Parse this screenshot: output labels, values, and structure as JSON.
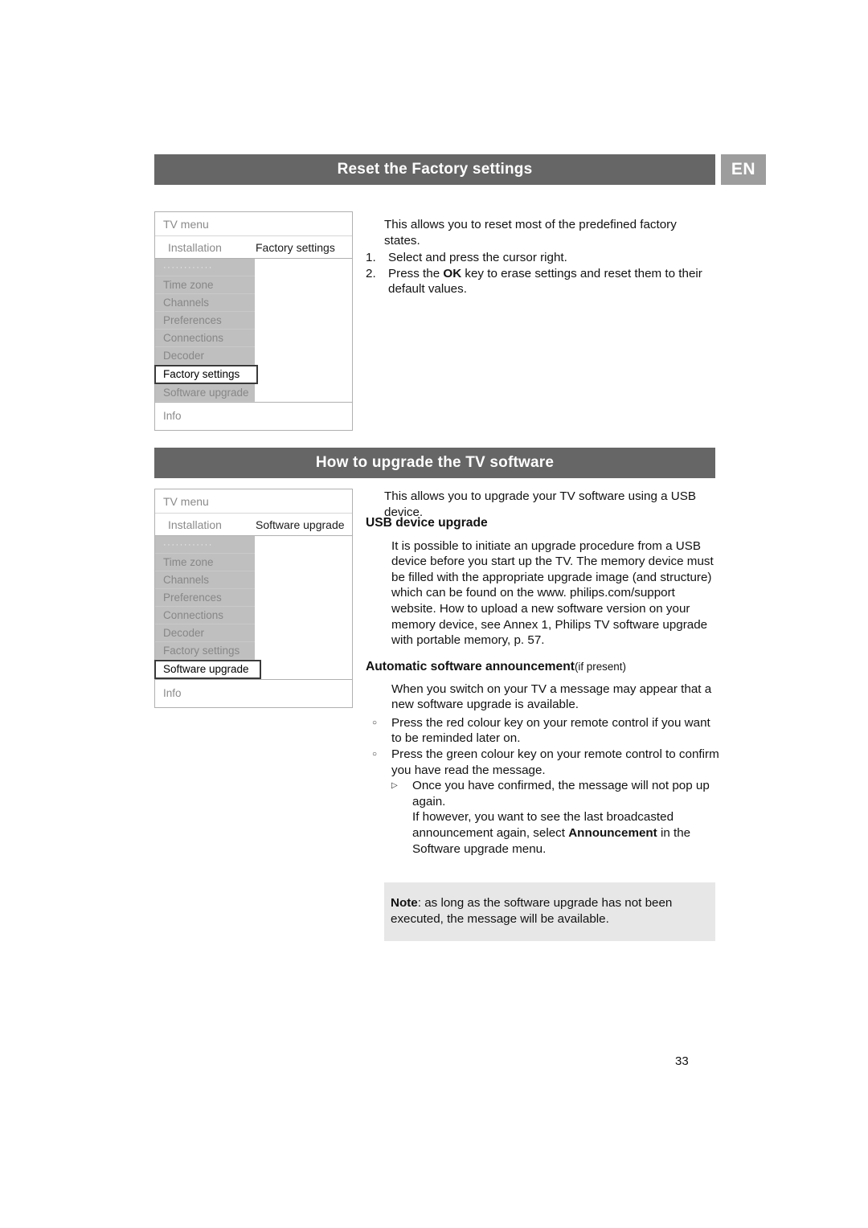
{
  "page": {
    "number": "33",
    "language_badge": "EN"
  },
  "sections": [
    {
      "id": "reset-factory-settings",
      "heading": "Reset the Factory settings",
      "tv_menu": {
        "title": "TV menu",
        "crumb_left": "Installation",
        "crumb_right": "Factory settings",
        "items": [
          "············",
          "Time zone",
          "Channels",
          "Preferences",
          "Connections",
          "Decoder",
          "Factory settings",
          "Software upgrade"
        ],
        "selected_item": "Factory settings",
        "footer": "Info"
      },
      "intro": "This allows you to reset most of the predefined factory states.",
      "steps": [
        {
          "num": "1.",
          "text_before": "Select and press the cursor right.",
          "bold": "",
          "text_after": ""
        },
        {
          "num": "2.",
          "text_before": "Press the ",
          "bold": "OK",
          "text_after": " key to erase settings and reset them to their default values."
        }
      ]
    },
    {
      "id": "upgrade-tv-software",
      "heading": "How to upgrade the TV software",
      "tv_menu": {
        "title": "TV menu",
        "crumb_left": "Installation",
        "crumb_right": "Software upgrade",
        "items": [
          "············",
          "Time zone",
          "Channels",
          "Preferences",
          "Connections",
          "Decoder",
          "Factory settings",
          "Software upgrade"
        ],
        "selected_item": "Software upgrade",
        "footer": "Info"
      },
      "intro": "This allows you to upgrade your TV software using a USB device.",
      "usb": {
        "heading": "USB device upgrade",
        "body": "It is possible to initiate an upgrade procedure from a USB device before you start up the TV. The memory device must be filled with the appropriate upgrade image (and structure) which can be found on the www. philips.com/support website. How to upload a new software version on your memory device, see Annex 1, Philips TV software upgrade with portable memory, p. 57."
      },
      "announcement": {
        "heading": "Automatic software announcement",
        "heading_suffix": "(if present)",
        "body": "When you switch on your TV a message may appear that a new software upgrade is available.",
        "bullets": [
          {
            "marker": "○",
            "text": "Press the red colour key on your remote control if you want to be reminded later on."
          },
          {
            "marker": "○",
            "text": "Press the green colour key on your remote control to confirm you have read the message."
          }
        ],
        "subbullet": {
          "marker": "▷",
          "line1": "Once you have confirmed, the message will not pop up again.",
          "line2_before": "If however, you want to see the last broadcasted announcement again, select ",
          "line2_bold": "Announcement",
          "line2_after": " in the Software upgrade menu."
        }
      },
      "note": {
        "label": "Note",
        "text": ": as long as the software upgrade has not been executed, the message will be available."
      }
    }
  ]
}
